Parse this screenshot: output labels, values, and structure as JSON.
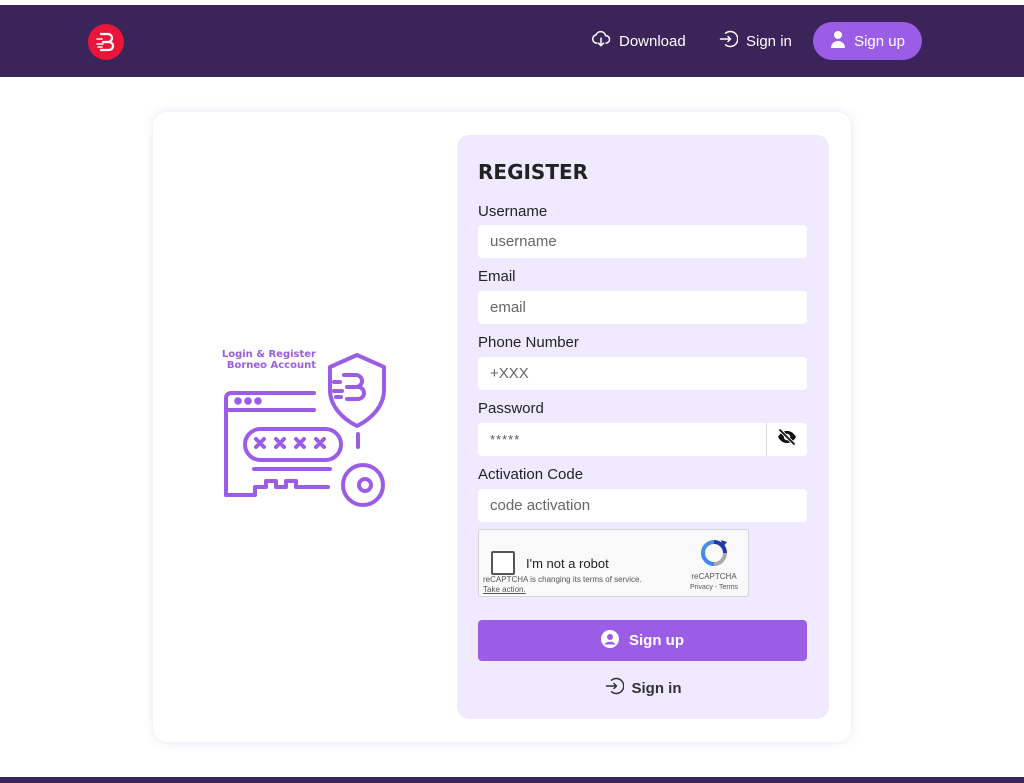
{
  "colors": {
    "navbar": "#3a2459",
    "accent": "#9b5de5",
    "logo": "#e8173a",
    "panel": "#efeaff"
  },
  "nav": {
    "logo_icon": "borneo-logo-icon",
    "download_label": "Download",
    "download_icon": "cloud-download-icon",
    "signin_label": "Sign in",
    "signin_icon": "sign-in-icon",
    "signup_label": "Sign up",
    "signup_icon": "user-icon"
  },
  "illustration": {
    "caption_line1": "Login & Register",
    "caption_line2": "Borneo Account",
    "icon": "key-password-shield-icon"
  },
  "form": {
    "title": "REGISTER",
    "username": {
      "label": "Username",
      "placeholder": "username",
      "value": ""
    },
    "email": {
      "label": "Email",
      "placeholder": "email",
      "value": ""
    },
    "phone": {
      "label": "Phone Number",
      "placeholder": "+XXX",
      "value": ""
    },
    "password": {
      "label": "Password",
      "placeholder": "*****",
      "value": "",
      "toggle_icon": "eye-slash-icon"
    },
    "activation": {
      "label": "Activation Code",
      "placeholder": "code activation",
      "value": ""
    },
    "recaptcha": {
      "label": "I'm not a robot",
      "notice": "reCAPTCHA is changing its terms of service.",
      "action": "Take action.",
      "brand": "reCAPTCHA",
      "links": "Privacy - Terms",
      "checked": false
    },
    "signup_button": "Sign up",
    "signin_link": "Sign in"
  }
}
